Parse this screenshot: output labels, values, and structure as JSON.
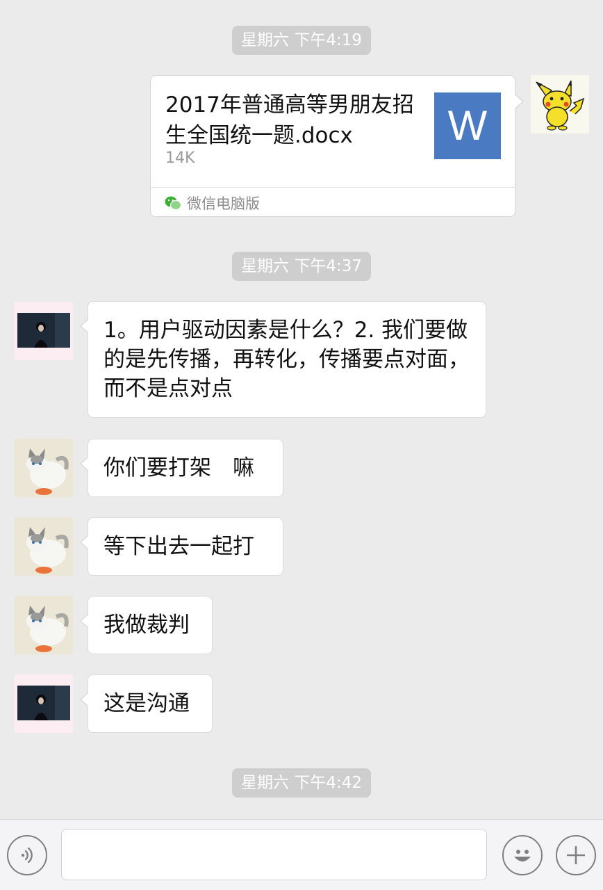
{
  "timestamps": {
    "t1": "星期六 下午4:19",
    "t2": "星期六 下午4:37",
    "t3": "星期六 下午4:42"
  },
  "file_message": {
    "file_name": "2017年普通高等男朋友招生全国统一题.docx",
    "file_size": "14K",
    "file_type_letter": "W",
    "source": "微信电脑版"
  },
  "messages": [
    {
      "text": "1。用户驱动因素是什么？2. 我们要做的是先传播，再转化，传播要点对面，而不是点对点"
    },
    {
      "text": "你们要打架　嘛"
    },
    {
      "text": "等下出去一起打"
    },
    {
      "text": "我做裁判"
    },
    {
      "text": "这是沟通"
    }
  ],
  "input_bar": {
    "placeholder": ""
  },
  "icons": {
    "voice": "voice-icon",
    "emoji": "emoji-icon",
    "add": "plus-icon",
    "file": "word-file-icon",
    "source": "wechat-logo-icon"
  },
  "colors": {
    "background": "#ebebeb",
    "timestamp_bg": "#cecece",
    "word_blue": "#4a7ac2",
    "wechat_green": "#3cb034"
  }
}
